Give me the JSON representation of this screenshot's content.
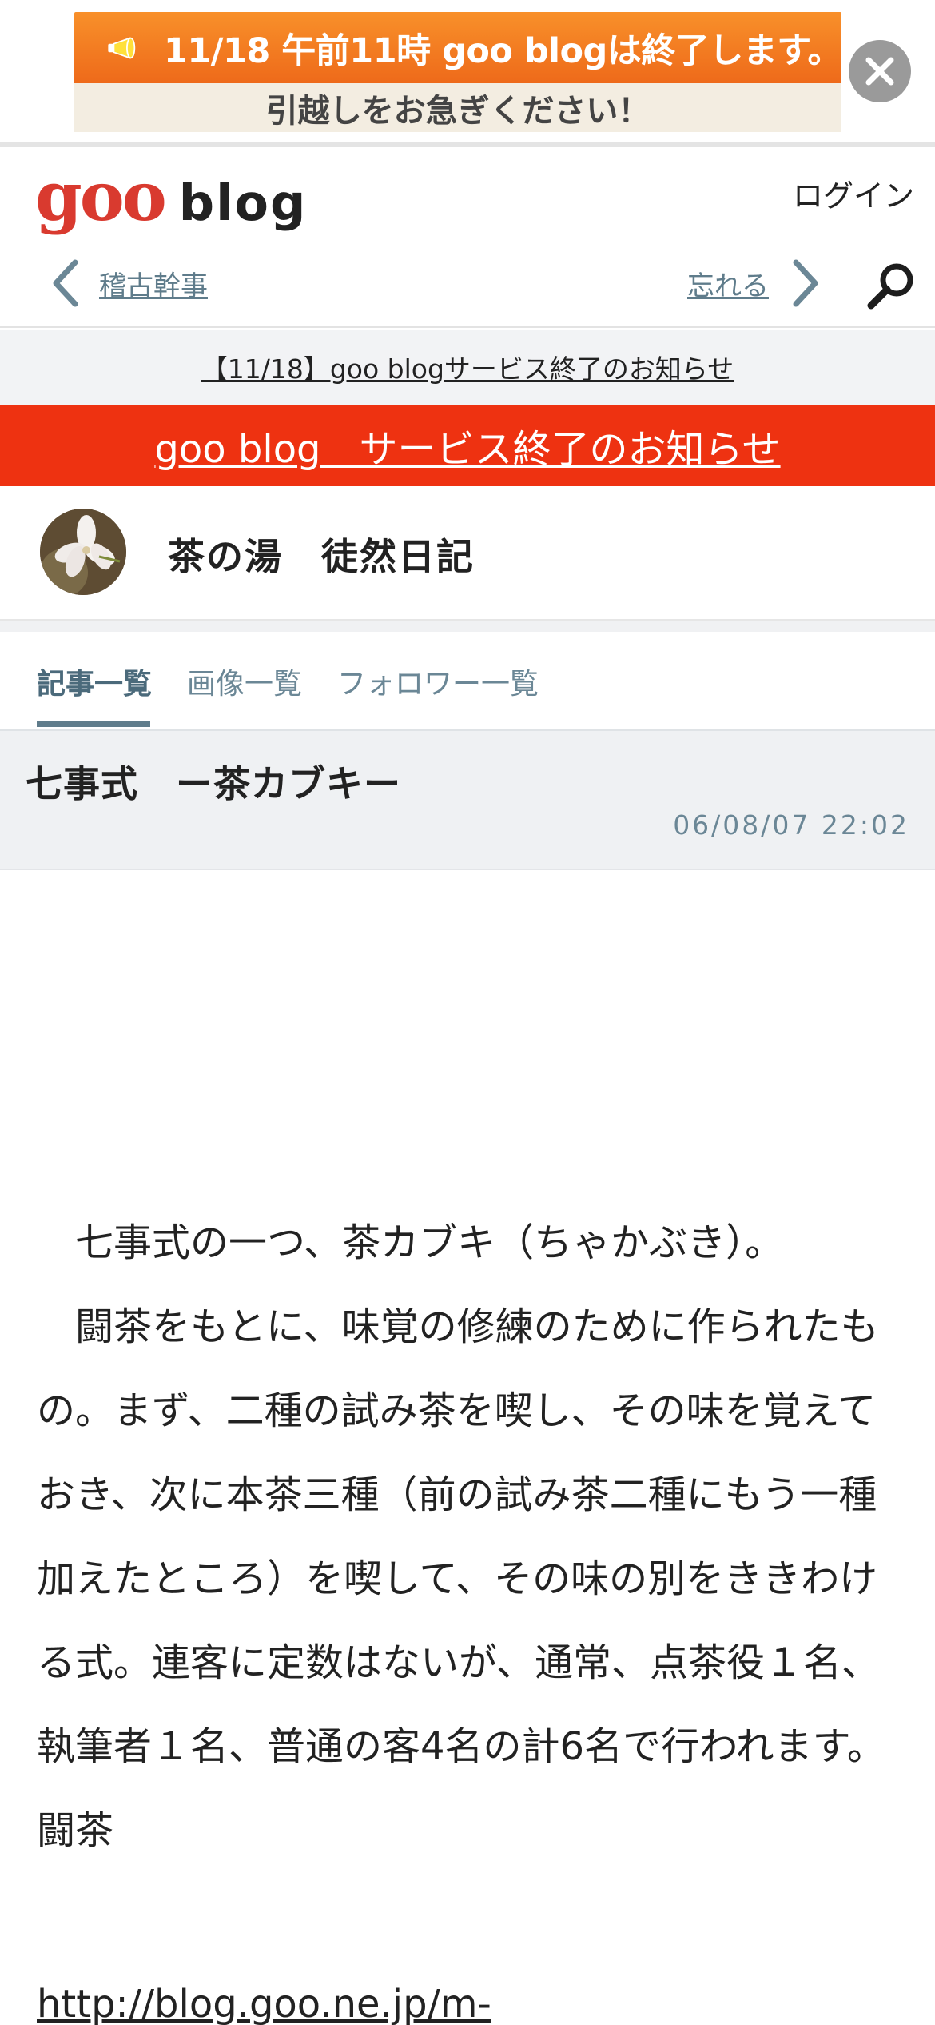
{
  "banner": {
    "headline": "11/18 午前11時 goo blogは終了します。",
    "subline": "引越しをお急ぎください！",
    "close_icon": "close-icon",
    "colors": {
      "orange": "#f07a22",
      "cream": "#f3ede1"
    }
  },
  "header": {
    "logo_goo": "goo",
    "logo_blog": "blog",
    "login_label": "ログイン",
    "prev_label": "稽古幹事",
    "next_label": "忘れる",
    "search_icon": "search-icon"
  },
  "notices": {
    "service_end_link": "【11/18】goo blogサービス終了のお知らせ",
    "red_banner": "goo blog　サービス終了のお知らせ",
    "red_color": "#ee3211"
  },
  "blog": {
    "name": "茶の湯　徒然日記",
    "avatar_icon": "flower-avatar"
  },
  "tabs": [
    {
      "label": "記事一覧",
      "active": true
    },
    {
      "label": "画像一覧",
      "active": false
    },
    {
      "label": "フォロワー一覧",
      "active": false
    }
  ],
  "article": {
    "title": "七事式　ー茶カブキー",
    "date": "06/08/07 22:02",
    "paragraphs": [
      "　七事式の一つ、茶カブキ（ちゃかぶき）。",
      "　闘茶をもとに、味覚の修練のために作られたもの。まず、二種の試み茶を喫し、その味を覚えておき、次に本茶三種（前の試み茶二種にもう一種加えたところ）を喫して、その味の別をききわける式。連客に定数はないが、通常、点茶役１名、執筆者１名、普通の客4名の計6名で行われます。",
      "闘茶"
    ],
    "link_text": "http://blog.goo.ne.jp/m-"
  }
}
